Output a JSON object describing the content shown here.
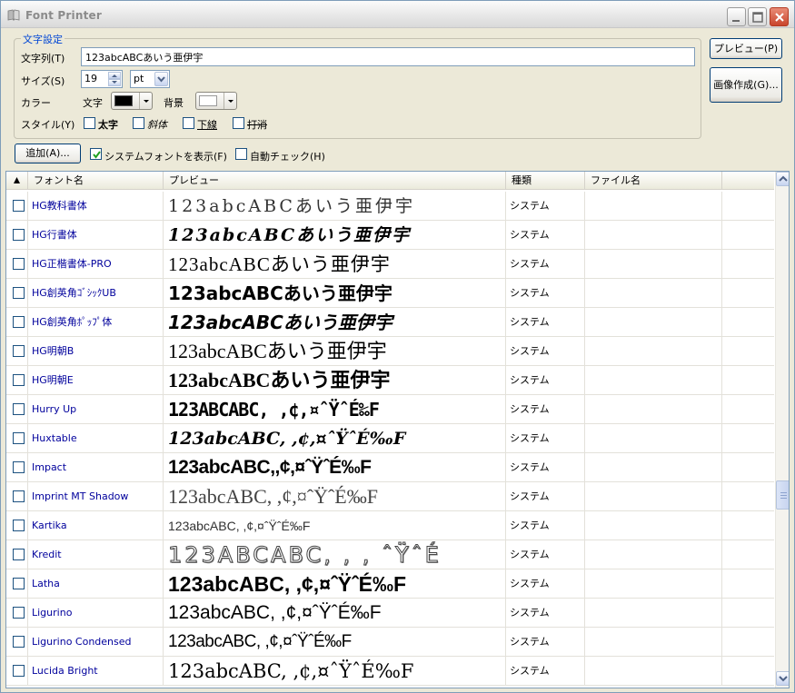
{
  "window": {
    "title": "Font Printer"
  },
  "settings": {
    "group_label": "文字設定",
    "text_label": "文字列(T)",
    "text_value": "123abcABCあいう亜伊宇",
    "size_label": "サイズ(S)",
    "size_value": "19",
    "unit_value": "pt",
    "color_label": "カラー",
    "fore_label": "文字",
    "fore_color": "#000000",
    "back_label": "背景",
    "back_color": "#ffffff",
    "style_label": "スタイル(Y)",
    "bold_label": "太字",
    "italic_label": "斜体",
    "underline_label": "下線",
    "strike_label": "打消"
  },
  "buttons": {
    "preview": "プレビュー(P)",
    "create_image": "画像作成(G)...",
    "add": "追加(A)..."
  },
  "options": {
    "show_system_fonts": "システムフォントを表示(F)",
    "show_system_checked": true,
    "auto_check": "自動チェック(H)",
    "auto_check_checked": false
  },
  "list": {
    "columns": {
      "font_name": "フォント名",
      "preview": "プレビュー",
      "kind": "種類",
      "file_name": "ファイル名"
    },
    "rows": [
      {
        "name": "HG教科書体",
        "preview": "123abcABCあいう亜伊宇",
        "kind": "システム"
      },
      {
        "name": "HG行書体",
        "preview": "123abcABCあいう亜伊宇",
        "kind": "システム"
      },
      {
        "name": "HG正楷書体-PRO",
        "preview": "123abcABCあいう亜伊宇",
        "kind": "システム"
      },
      {
        "name": "HG創英角ｺﾞｼｯｸUB",
        "preview": "123abcABCあいう亜伊宇",
        "kind": "システム"
      },
      {
        "name": "HG創英角ﾎﾟｯﾌﾟ体",
        "preview": "123abcABCあいう亜伊宇",
        "kind": "システム"
      },
      {
        "name": "HG明朝B",
        "preview": "123abcABCあいう亜伊宇",
        "kind": "システム"
      },
      {
        "name": "HG明朝E",
        "preview": "123abcABCあいう亜伊宇",
        "kind": "システム"
      },
      {
        "name": "Hurry Up",
        "preview": "123ABCABC, ,¢,¤ˆŸˆÉ‰F",
        "kind": "システム"
      },
      {
        "name": "Huxtable",
        "preview": "123abcABC, ,¢,¤ˆŸˆÉ‰F",
        "kind": "システム"
      },
      {
        "name": "Impact",
        "preview": "123abcABC,,¢,¤ˆŸˆÉ‰F",
        "kind": "システム"
      },
      {
        "name": "Imprint MT Shadow",
        "preview": "123abcABC, ,¢,¤ˆŸˆÉ‰F",
        "kind": "システム"
      },
      {
        "name": "Kartika",
        "preview": "123abcABC, ,¢,¤ˆŸˆÉ‰F",
        "kind": "システム"
      },
      {
        "name": "Kredit",
        "preview": "123ABCABC, , , ˆŸˆÉ",
        "kind": "システム"
      },
      {
        "name": "Latha",
        "preview": "123abcABC, ,¢,¤ˆŸˆÉ‰F",
        "kind": "システム"
      },
      {
        "name": "Ligurino",
        "preview": "123abcABC, ,¢,¤ˆŸˆÉ‰F",
        "kind": "システム"
      },
      {
        "name": "Ligurino Condensed",
        "preview": "123abcABC, ,¢,¤ˆŸˆÉ‰F",
        "kind": "システム"
      },
      {
        "name": "Lucida Bright",
        "preview": "123abcABC, ,¢,¤ˆŸˆÉ‰F",
        "kind": "システム"
      }
    ]
  }
}
